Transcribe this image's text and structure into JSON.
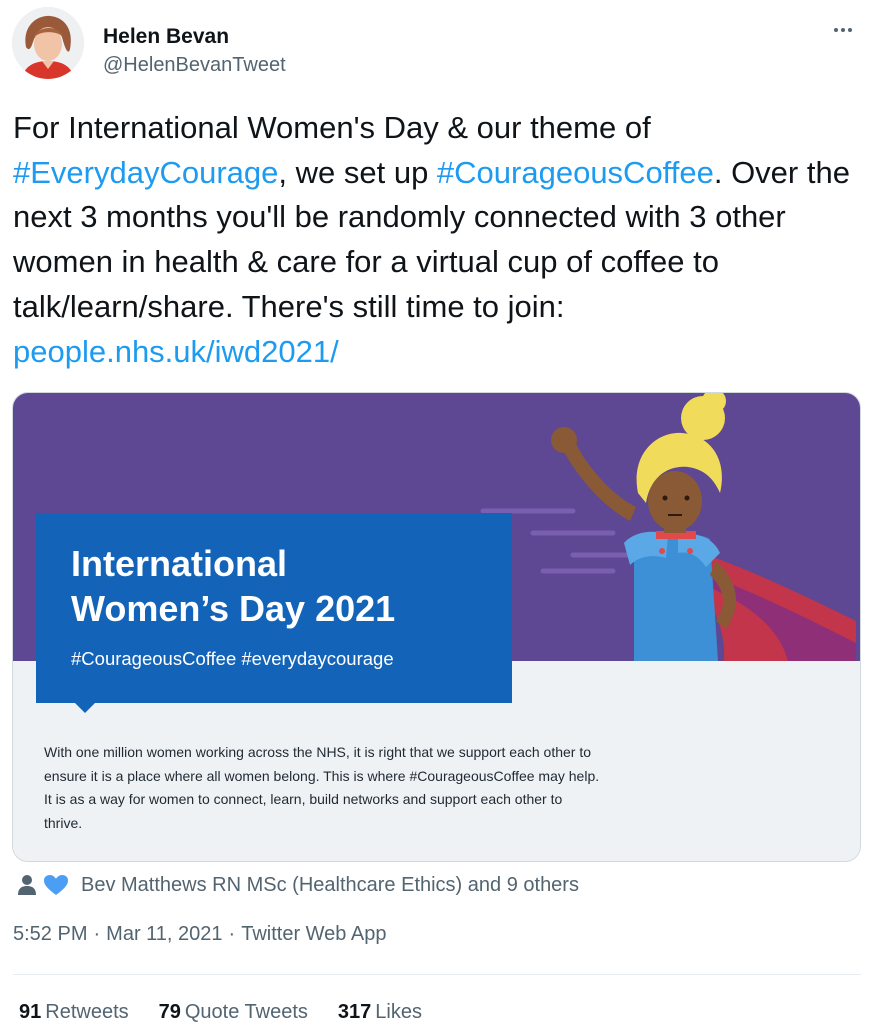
{
  "author": {
    "name": "Helen Bevan",
    "handle": "@HelenBevanTweet"
  },
  "tweet": {
    "segments": [
      {
        "text": "For International Women's Day & our theme of ",
        "link": false
      },
      {
        "text": "#EverydayCourage",
        "link": true
      },
      {
        "text": ", we set up ",
        "link": false
      },
      {
        "text": "#CourageousCoffee",
        "link": true
      },
      {
        "text": ". Over the next 3 months you'll be randomly connected with 3 other women in health & care for a virtual cup of coffee to talk/learn/share. There's still time to join: ",
        "link": false
      },
      {
        "text": "people.nhs.uk/iwd2021/",
        "link": true
      }
    ]
  },
  "media": {
    "title_line1": "International",
    "title_line2": "Women’s Day 2021",
    "hashtags": "#CourageousCoffee #everydaycourage",
    "body": "With one million women working across the NHS, it is right that we support each other to ensure it is a place where all women belong. This is where #CourageousCoffee may help. It is as a way for women to connect, learn, build networks and support each other to thrive."
  },
  "likers": {
    "text": "Bev Matthews RN MSc (Healthcare Ethics) and 9 others"
  },
  "meta": {
    "time": "5:52 PM",
    "date": "Mar 11, 2021",
    "app": "Twitter Web App"
  },
  "stats": {
    "retweets_count": "91",
    "retweets_label": "Retweets",
    "quotes_count": "79",
    "quotes_label": "Quote Tweets",
    "likes_count": "317",
    "likes_label": "Likes"
  },
  "colors": {
    "link": "#1d9bf0",
    "secondary_text": "#536471",
    "media_purple": "#5e4793",
    "media_blue_box": "#1364b8",
    "heart": "#4a9ff5"
  },
  "icons": [
    "more-icon",
    "person-icon",
    "heart-icon"
  ]
}
